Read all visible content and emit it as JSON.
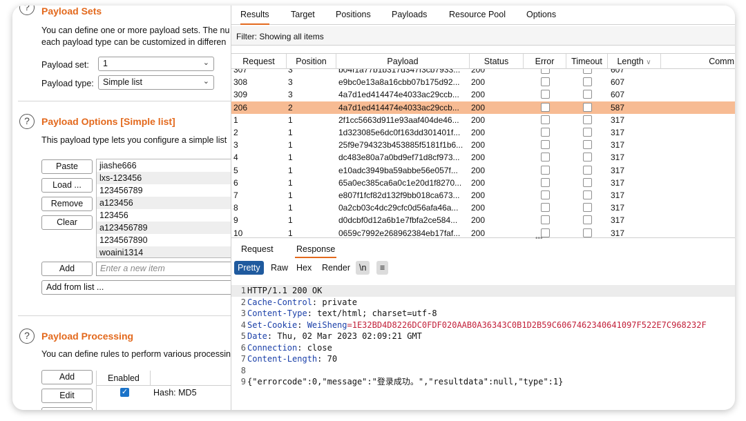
{
  "payload_sets": {
    "title": "Payload Sets",
    "desc_line1": "You can define one or more payload sets. The nu",
    "desc_line2": "each payload type can be customized in differen",
    "set_label": "Payload set:",
    "set_value": "1",
    "type_label": "Payload type:",
    "type_value": "Simple list"
  },
  "payload_options": {
    "title": "Payload Options [Simple list]",
    "desc": "This payload type lets you configure a simple list",
    "buttons": {
      "paste": "Paste",
      "load": "Load ...",
      "remove": "Remove",
      "clear": "Clear",
      "add": "Add"
    },
    "items": [
      "jiashe666",
      "lxs-123456",
      "123456789",
      "a123456",
      "123456",
      "a123456789",
      "1234567890",
      "woaini1314"
    ],
    "new_item_placeholder": "Enter a new item",
    "add_from_list": "Add from list ..."
  },
  "payload_processing": {
    "title": "Payload Processing",
    "desc": "You can define rules to perform various processin",
    "add_label": "Add",
    "edit_label": "Edit",
    "enabled_header": "Enabled",
    "rule": "Hash: MD5",
    "help_symbol": "?"
  },
  "results": {
    "tabs": [
      "Results",
      "Target",
      "Positions",
      "Payloads",
      "Resource Pool",
      "Options"
    ],
    "filter": "Filter: Showing all items",
    "columns": [
      "Request",
      "Position",
      "Payload",
      "Status",
      "Error",
      "Timeout",
      "Length",
      "Comm"
    ],
    "sort_indicator": "∨",
    "rows": [
      {
        "request": "307",
        "position": "3",
        "payload": "b04f1a77b1b317d347f3cb7933...",
        "status": "200",
        "length": "607"
      },
      {
        "request": "308",
        "position": "3",
        "payload": "e9bc0e13a8a16cbb07b175d92...",
        "status": "200",
        "length": "607"
      },
      {
        "request": "309",
        "position": "3",
        "payload": "4a7d1ed414474e4033ac29ccb...",
        "status": "200",
        "length": "607"
      },
      {
        "request": "206",
        "position": "2",
        "payload": "4a7d1ed414474e4033ac29ccb...",
        "status": "200",
        "length": "587"
      },
      {
        "request": "1",
        "position": "1",
        "payload": "2f1cc5663d911e93aaf404de46...",
        "status": "200",
        "length": "317"
      },
      {
        "request": "2",
        "position": "1",
        "payload": "1d323085e6dc0f163dd301401f...",
        "status": "200",
        "length": "317"
      },
      {
        "request": "3",
        "position": "1",
        "payload": "25f9e794323b453885f5181f1b6...",
        "status": "200",
        "length": "317"
      },
      {
        "request": "4",
        "position": "1",
        "payload": "dc483e80a7a0bd9ef71d8cf973...",
        "status": "200",
        "length": "317"
      },
      {
        "request": "5",
        "position": "1",
        "payload": "e10adc3949ba59abbe56e057f...",
        "status": "200",
        "length": "317"
      },
      {
        "request": "6",
        "position": "1",
        "payload": "65a0ec385ca6a0c1e20d1f8270...",
        "status": "200",
        "length": "317"
      },
      {
        "request": "7",
        "position": "1",
        "payload": "e807f1fcf82d132f9bb018ca673...",
        "status": "200",
        "length": "317"
      },
      {
        "request": "8",
        "position": "1",
        "payload": "0a2cb03c4dc29cfc0d56afa46a...",
        "status": "200",
        "length": "317"
      },
      {
        "request": "9",
        "position": "1",
        "payload": "d0dcbf0d12a6b1e7fbfa2ce584...",
        "status": "200",
        "length": "317"
      },
      {
        "request": "10",
        "position": "1",
        "payload": "0659c7992e268962384eb17faf...",
        "status": "200",
        "length": "317"
      }
    ],
    "selected_request": "206",
    "splitter": "•••"
  },
  "detail": {
    "tabs": [
      "Request",
      "Response"
    ],
    "view_buttons": [
      "Pretty",
      "Raw",
      "Hex",
      "Render"
    ],
    "newline_button": "\\n",
    "menu_symbol": "≡",
    "lines": [
      {
        "n": "1",
        "key": "",
        "val": "HTTP/1.1 200 OK"
      },
      {
        "n": "2",
        "key": "Cache-Control",
        "val": ": private"
      },
      {
        "n": "3",
        "key": "Content-Type",
        "val": ": text/html; charset=utf-8"
      },
      {
        "n": "4",
        "key": "Set-Cookie",
        "cookie_name": "WeiSheng",
        "cookie_val": "=1E32BD4D8226DC0FDF020AAB0A36343C0B1D2B59C6067462340641097F522E7C968232F"
      },
      {
        "n": "5",
        "key": "Date",
        "val": ": Thu, 02 Mar 2023 02:09:21 GMT"
      },
      {
        "n": "6",
        "key": "Connection",
        "val": ": close"
      },
      {
        "n": "7",
        "key": "Content-Length",
        "val": ": 70"
      },
      {
        "n": "8",
        "key": "",
        "val": ""
      },
      {
        "n": "9",
        "key": "",
        "val": "{\"errorcode\":0,\"message\":\"登录成功。\",\"resultdata\":null,\"type\":1}"
      }
    ]
  },
  "colors": {
    "accent": "#e3691d",
    "selected_row": "#f7bb93",
    "pretty_active": "#1f5a9e"
  }
}
